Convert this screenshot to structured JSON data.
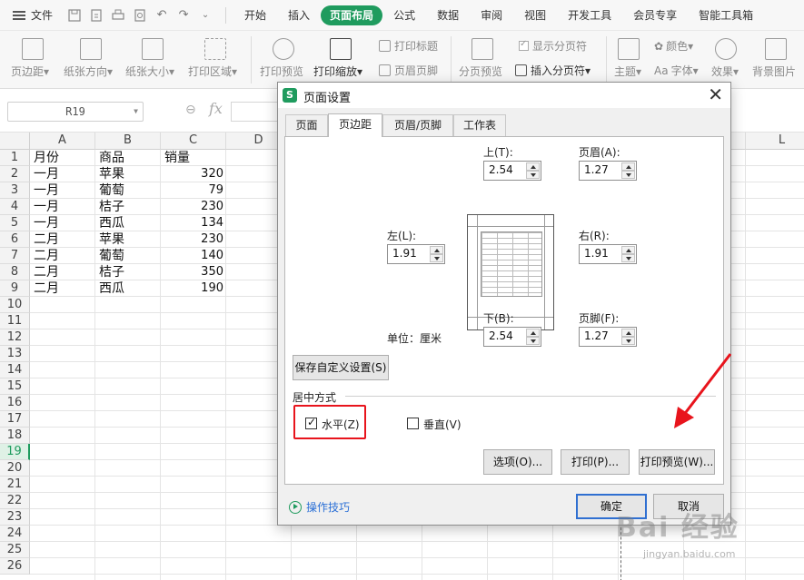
{
  "menubar": {
    "file_label": "文件",
    "tabs": [
      "开始",
      "插入",
      "页面布局",
      "公式",
      "数据",
      "审阅",
      "视图",
      "开发工具",
      "会员专享",
      "智能工具箱"
    ],
    "active_tab": "页面布局"
  },
  "ribbon": {
    "margins": "页边距",
    "orientation": "纸张方向",
    "size": "纸张大小",
    "print_area": "打印区域",
    "print_preview": "打印预览",
    "print_scale": "打印缩放",
    "print_titles": "打印标题",
    "header_footer": "页眉页脚",
    "page_break_preview": "分页预览",
    "show_page_breaks": "显示分页符",
    "insert_page_break": "插入分页符",
    "theme": "主题",
    "colors": "颜色",
    "fonts": "字体",
    "effects": "效果",
    "background": "背景图片"
  },
  "formula_bar": {
    "name_box": "R19",
    "fx": "fx"
  },
  "sheet": {
    "columns": [
      "A",
      "B",
      "C",
      "D",
      "L"
    ],
    "rows": [
      "1",
      "2",
      "3",
      "4",
      "5",
      "6",
      "7",
      "8",
      "9",
      "10",
      "11",
      "12",
      "13",
      "14",
      "15",
      "16",
      "17",
      "18",
      "19",
      "20",
      "21",
      "22",
      "23",
      "24",
      "25",
      "26"
    ],
    "selected_row": "19",
    "headers": [
      "月份",
      "商品",
      "销量"
    ],
    "data": [
      [
        "一月",
        "苹果",
        "320"
      ],
      [
        "一月",
        "葡萄",
        "79"
      ],
      [
        "一月",
        "桔子",
        "230"
      ],
      [
        "一月",
        "西瓜",
        "134"
      ],
      [
        "二月",
        "苹果",
        "230"
      ],
      [
        "二月",
        "葡萄",
        "140"
      ],
      [
        "二月",
        "桔子",
        "350"
      ],
      [
        "二月",
        "西瓜",
        "190"
      ]
    ]
  },
  "dialog": {
    "logo": "S",
    "title": "页面设置",
    "tabs": [
      "页面",
      "页边距",
      "页眉/页脚",
      "工作表"
    ],
    "active_tab": "页边距",
    "top_label": "上(T):",
    "top_value": "2.54",
    "header_label": "页眉(A):",
    "header_value": "1.27",
    "left_label": "左(L):",
    "left_value": "1.91",
    "right_label": "右(R):",
    "right_value": "1.91",
    "bottom_label": "下(B):",
    "bottom_value": "2.54",
    "footer_label": "页脚(F):",
    "footer_value": "1.27",
    "unit_label": "单位：厘米",
    "save_custom": "保存自定义设置(S)",
    "center_group": "居中方式",
    "horizontal": "水平(Z)",
    "vertical": "垂直(V)",
    "options_btn": "选项(O)...",
    "print_btn": "打印(P)...",
    "preview_btn": "打印预览(W)...",
    "tips": "操作技巧",
    "ok": "确定",
    "cancel": "取消"
  },
  "colors": {
    "accent": "#1f9b5e",
    "highlight": "#e8141c",
    "link": "#2a6fd6"
  },
  "watermark": {
    "text": "Bai 经验",
    "url": "jingyan.baidu.com"
  }
}
